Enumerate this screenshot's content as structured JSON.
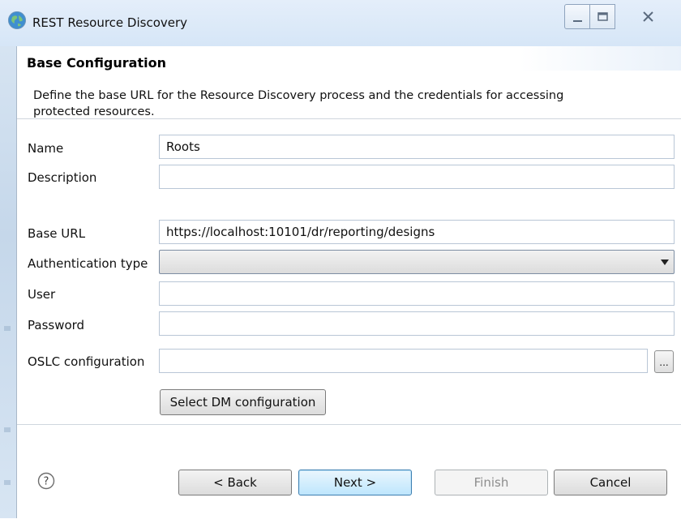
{
  "window": {
    "title": "REST Resource Discovery",
    "icon": "globe-icon",
    "controls": [
      "minimize-icon",
      "maximize-icon",
      "close-icon"
    ]
  },
  "header": {
    "title": "Base Configuration",
    "description": "Define the base URL for the Resource Discovery process and the credentials for accessing protected resources."
  },
  "form": {
    "name_label": "Name",
    "name_value": "Roots",
    "description_label": "Description",
    "description_value": "",
    "base_url_label": "Base URL",
    "base_url_value": "https://localhost:10101/dr/reporting/designs",
    "auth_type_label": "Authentication type",
    "auth_type_value": "",
    "user_label": "User",
    "user_value": "",
    "password_label": "Password",
    "password_value": "",
    "oslc_label": "OSLC configuration",
    "oslc_value": "",
    "browse_label": "...",
    "select_dm_label": "Select DM configuration"
  },
  "footer": {
    "help_icon": "help-question-icon",
    "back_label": "< Back",
    "next_label": "Next >",
    "finish_label": "Finish",
    "cancel_label": "Cancel"
  },
  "colors": {
    "titlebar": "#d6e6f7",
    "default_button": "#bee6fd",
    "default_button_border": "#3c7fb1"
  }
}
